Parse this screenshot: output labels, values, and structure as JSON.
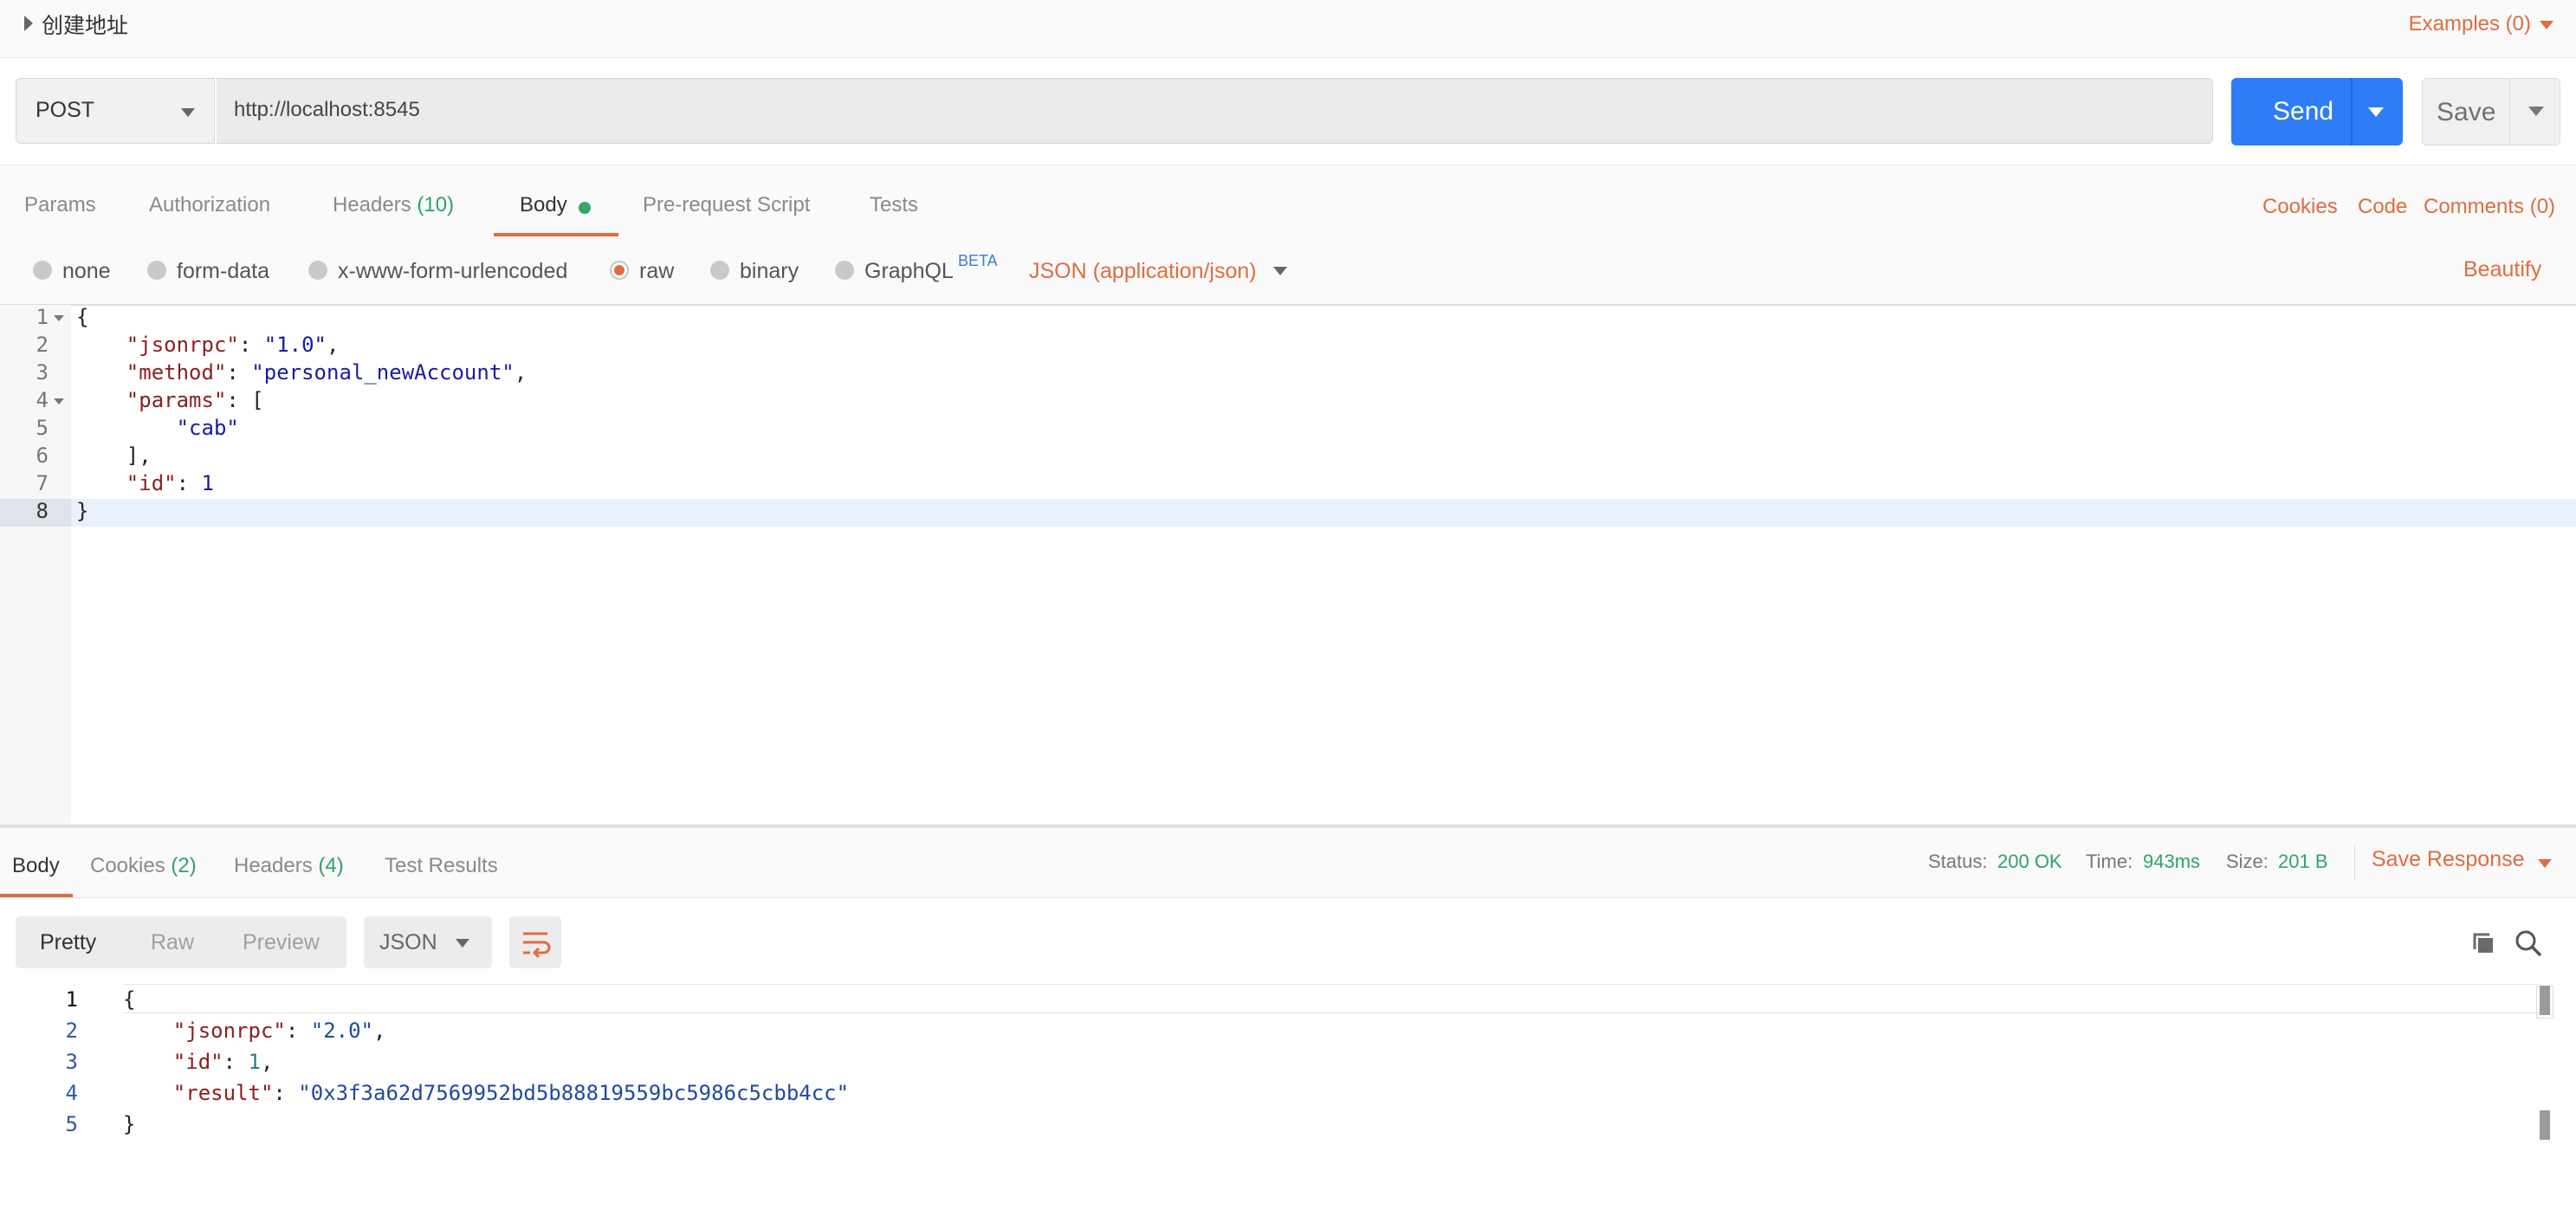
{
  "title": "创建地址",
  "examples_label": "Examples (0)",
  "request": {
    "method": "POST",
    "url": "http://localhost:8545",
    "send_label": "Send",
    "save_label": "Save"
  },
  "req_tabs": {
    "params": "Params",
    "authorization": "Authorization",
    "headers": "Headers",
    "headers_count": "(10)",
    "body": "Body",
    "prerequest": "Pre-request Script",
    "tests": "Tests",
    "cookies": "Cookies",
    "code": "Code",
    "comments": "Comments (0)"
  },
  "body_types": {
    "none": "none",
    "form_data": "form-data",
    "urlencoded": "x-www-form-urlencoded",
    "raw": "raw",
    "binary": "binary",
    "graphql": "GraphQL",
    "beta": "BETA",
    "selected": "raw",
    "content_type": "JSON (application/json)",
    "beautify": "Beautify"
  },
  "request_body": {
    "line_numbers": [
      "1",
      "2",
      "3",
      "4",
      "5",
      "6",
      "7",
      "8"
    ],
    "l1": "{",
    "k_jsonrpc": "\"jsonrpc\"",
    "v_jsonrpc": "\"1.0\"",
    "k_method": "\"method\"",
    "v_method": "\"personal_newAccount\"",
    "k_params": "\"params\"",
    "params_open": "[",
    "v_param0": "\"cab\"",
    "params_close": "],",
    "k_id": "\"id\"",
    "v_id": "1",
    "l8": "}"
  },
  "response_tabs": {
    "body": "Body",
    "cookies": "Cookies",
    "cookies_count": "(2)",
    "headers": "Headers",
    "headers_count": "(4)",
    "test_results": "Test Results"
  },
  "response_status": {
    "status_label": "Status:",
    "status_value": "200 OK",
    "time_label": "Time:",
    "time_value": "943ms",
    "size_label": "Size:",
    "size_value": "201 B",
    "save_response": "Save Response"
  },
  "response_view": {
    "pretty": "Pretty",
    "raw": "Raw",
    "preview": "Preview",
    "format": "JSON"
  },
  "response_body": {
    "line_numbers": [
      "1",
      "2",
      "3",
      "4",
      "5"
    ],
    "l1": "{",
    "k_jsonrpc": "\"jsonrpc\"",
    "v_jsonrpc": "\"2.0\"",
    "k_id": "\"id\"",
    "v_id": "1",
    "k_result": "\"result\"",
    "v_result": "\"0x3f3a62d7569952bd5b88819559bc5986c5cbb4cc\"",
    "l5": "}"
  },
  "icons": {
    "wrap": "wrap-lines-icon",
    "copy": "copy-icon",
    "search": "search-icon"
  },
  "colors": {
    "accent": "#e06c3f",
    "send": "#2e7cf6",
    "success": "#2fa26d"
  }
}
